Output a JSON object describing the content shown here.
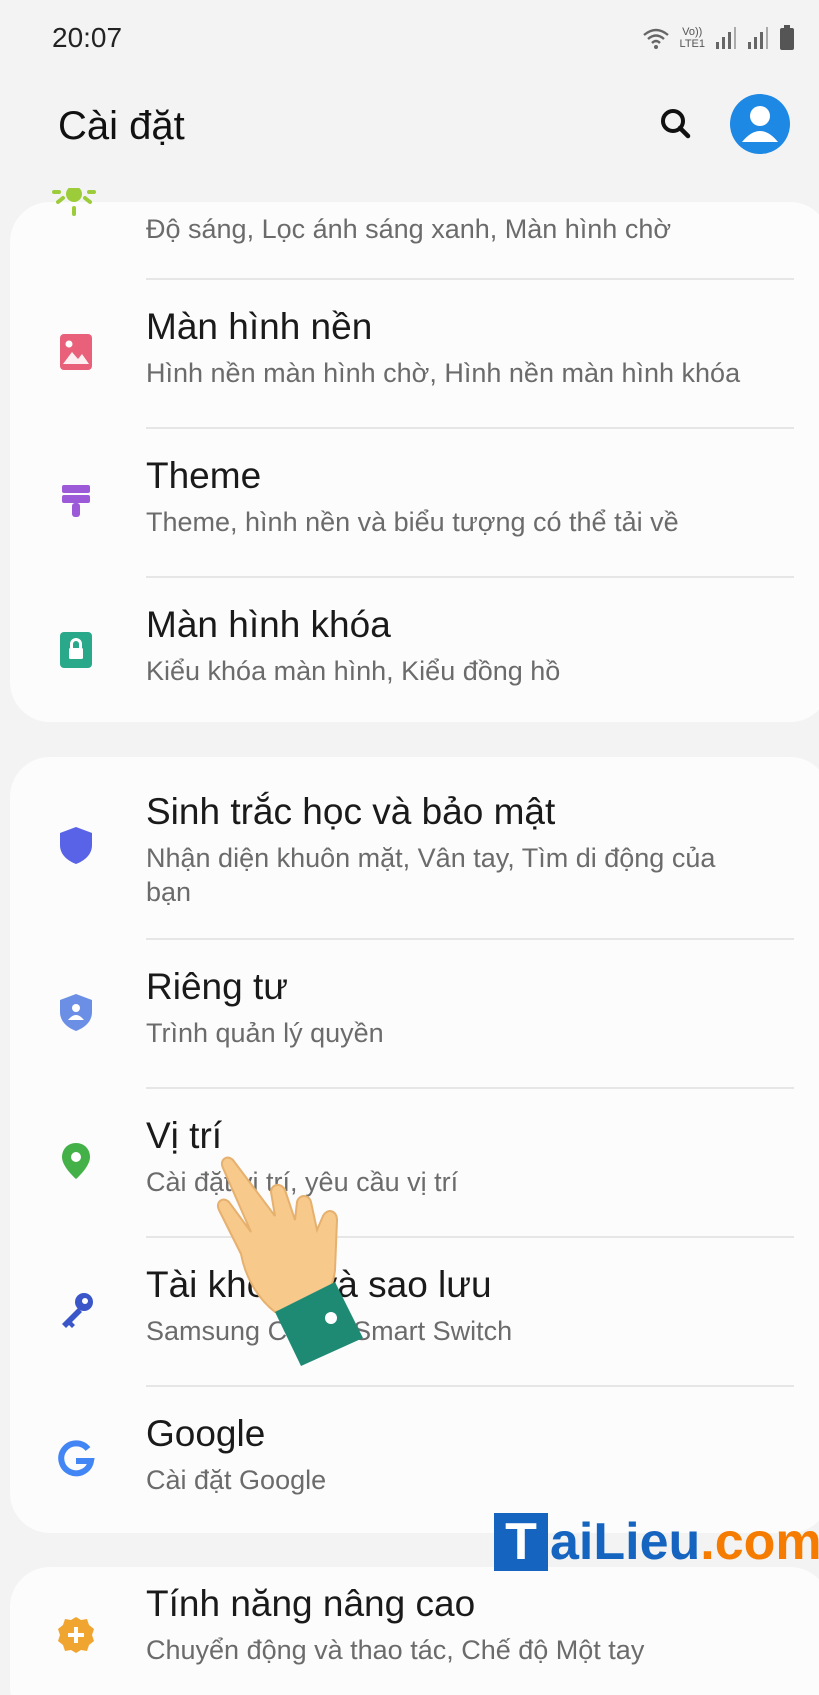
{
  "status": {
    "time": "20:07",
    "volte": "Vo))",
    "lte": "LTE1"
  },
  "header": {
    "title": "Cài đặt"
  },
  "groups": [
    {
      "items": [
        {
          "icon": "sun-icon",
          "title": "",
          "subtitle": "Độ sáng, Lọc ánh sáng xanh, Màn hình chờ"
        },
        {
          "icon": "wallpaper-icon",
          "title": "Màn hình nền",
          "subtitle": "Hình nền màn hình chờ, Hình nền màn hình khóa"
        },
        {
          "icon": "paint-brush-icon",
          "title": "Theme",
          "subtitle": "Theme, hình nền và biểu tượng có thể tải về"
        },
        {
          "icon": "lock-icon",
          "title": "Màn hình khóa",
          "subtitle": "Kiểu khóa màn hình, Kiểu đồng hồ"
        }
      ]
    },
    {
      "items": [
        {
          "icon": "shield-icon",
          "title": "Sinh trắc học và bảo mật",
          "subtitle": "Nhận diện khuôn mặt, Vân tay, Tìm di động của bạn"
        },
        {
          "icon": "privacy-shield-icon",
          "title": "Riêng tư",
          "subtitle": "Trình quản lý quyền"
        },
        {
          "icon": "location-pin-icon",
          "title": "Vị trí",
          "subtitle": "Cài đặt vị trí, yêu cầu vị trí"
        },
        {
          "icon": "key-icon",
          "title": "Tài khoản và sao lưu",
          "subtitle": "Samsung Cloud, Smart Switch"
        },
        {
          "icon": "google-icon",
          "title": "Google",
          "subtitle": "Cài đặt Google"
        }
      ]
    },
    {
      "items": [
        {
          "icon": "gear-plus-icon",
          "title": "Tính năng nâng cao",
          "subtitle": "Chuyển động và thao tác, Chế độ Một tay"
        }
      ]
    }
  ],
  "watermark": {
    "first_letter": "T",
    "main": "aiLieu",
    "suffix": ".com"
  },
  "colors": {
    "wallpaper": "#e8607a",
    "theme": "#9c5ad8",
    "lock": "#2aa98a",
    "security": "#5863e8",
    "privacy": "#6c8fe6",
    "location": "#43b048",
    "key": "#3a56c8",
    "advanced": "#f1a531",
    "avatar": "#1e88e5"
  }
}
